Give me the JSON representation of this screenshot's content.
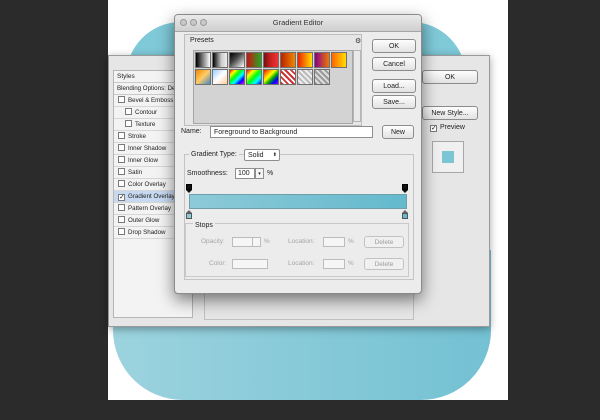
{
  "gradient_editor": {
    "title": "Gradient Editor",
    "presets_label": "Presets",
    "gear_icon": "gear-icon",
    "buttons": {
      "ok": "OK",
      "cancel": "Cancel",
      "load": "Load...",
      "save": "Save..."
    },
    "name_label": "Name:",
    "name_value": "Foreground to Background",
    "new_button": "New",
    "gradient_type_label": "Gradient Type:",
    "gradient_type_value": "Solid",
    "smoothness_label": "Smoothness:",
    "smoothness_value": "100",
    "percent": "%",
    "stops": {
      "label": "Stops",
      "opacity_label": "Opacity:",
      "location_label": "Location:",
      "color_label": "Color:",
      "delete_label": "Delete",
      "percent": "%"
    },
    "gradient_colors": [
      "#8dcad8",
      "#64b9cd"
    ]
  },
  "layer_style": {
    "styles_header": "Styles",
    "blending_options": "Blending Options: Def",
    "items": [
      {
        "label": "Bevel & Emboss",
        "checked": false
      },
      {
        "label": "Contour",
        "checked": false
      },
      {
        "label": "Texture",
        "checked": false
      },
      {
        "label": "Stroke",
        "checked": false
      },
      {
        "label": "Inner Shadow",
        "checked": false
      },
      {
        "label": "Inner Glow",
        "checked": false
      },
      {
        "label": "Satin",
        "checked": false
      },
      {
        "label": "Color Overlay",
        "checked": false
      },
      {
        "label": "Gradient Overlay",
        "checked": true
      },
      {
        "label": "Pattern Overlay",
        "checked": false
      },
      {
        "label": "Outer Glow",
        "checked": false
      },
      {
        "label": "Drop Shadow",
        "checked": false
      }
    ],
    "ok": "OK",
    "new_style": "New Style...",
    "preview_label": "Preview",
    "preview_checked": true
  },
  "colors": {
    "shape": "#7fc9d8",
    "selected_row": "#c6d9f0"
  }
}
